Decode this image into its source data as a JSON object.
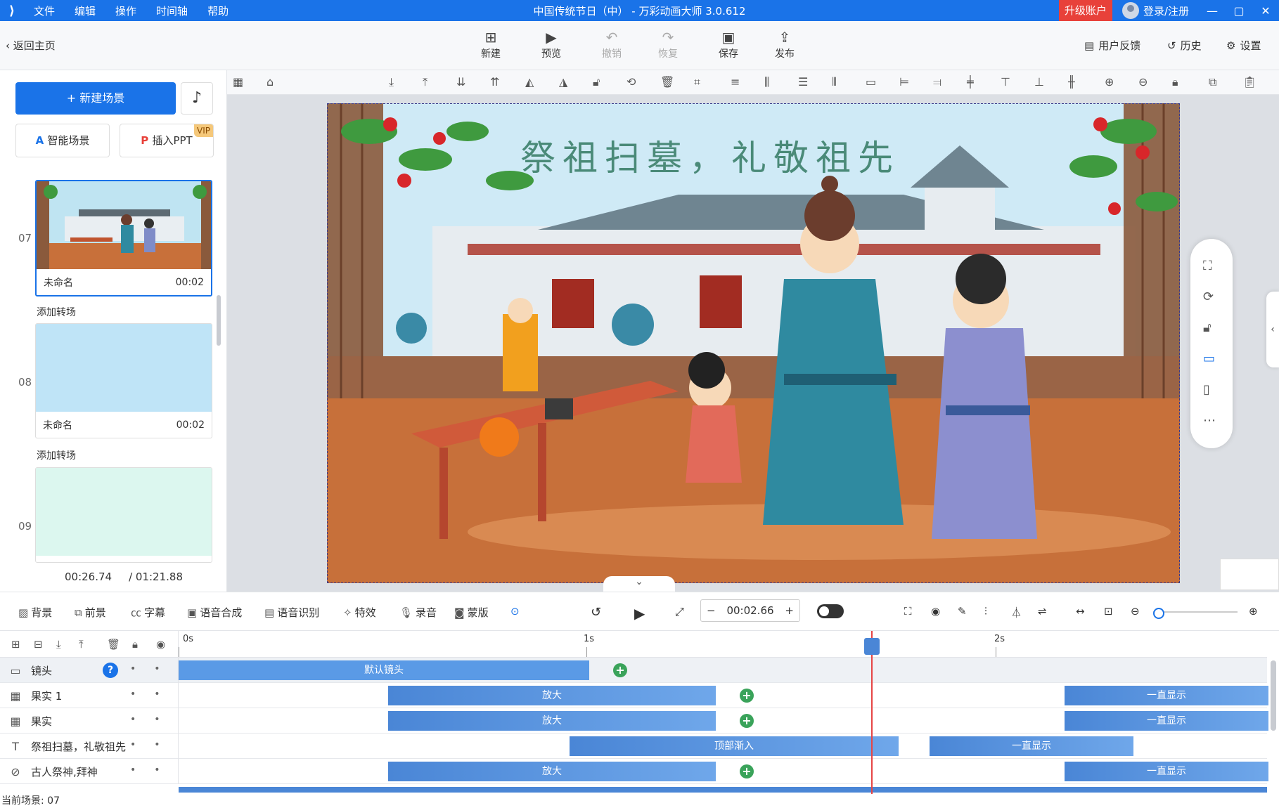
{
  "app": {
    "title": "中国传统节日（中） - 万彩动画大师 3.0.612",
    "menu": [
      "文件",
      "编辑",
      "操作",
      "时间轴",
      "帮助"
    ],
    "upgrade": "升级账户",
    "login": "登录/注册"
  },
  "toolbar": {
    "back": "返回主页",
    "new": "新建",
    "preview": "预览",
    "undo": "撤销",
    "redo": "恢复",
    "save": "保存",
    "publish": "发布",
    "feedback": "用户反馈",
    "history": "历史",
    "settings": "设置"
  },
  "left": {
    "new_scene": "+ 新建场景",
    "smart_scene": "智能场景",
    "insert_ppt": "插入PPT",
    "vip": "VIP",
    "add_transition": "添加转场",
    "scenes": [
      {
        "no": "07",
        "name": "未命名",
        "dur": "00:02"
      },
      {
        "no": "08",
        "name": "未命名",
        "dur": "00:02"
      },
      {
        "no": "09",
        "name": "",
        "dur": ""
      }
    ],
    "time_current": "00:26.74",
    "time_total": "/ 01:21.88"
  },
  "canvas": {
    "headline": "祭祖扫墓，礼敬祖先"
  },
  "controls": {
    "background": "背景",
    "foreground": "前景",
    "subtitle": "字幕",
    "tts": "语音合成",
    "asr": "语音识别",
    "effects": "特效",
    "record": "录音",
    "mask": "蒙版",
    "time": "00:02.66"
  },
  "timeline": {
    "ruler": [
      "0s",
      "1s",
      "2s"
    ],
    "status": "当前场景: 07",
    "tracks": [
      {
        "name": "镜头",
        "clips": [
          "默认镜头"
        ]
      },
      {
        "name": "果实 1",
        "clips": [
          "放大",
          "一直显示"
        ]
      },
      {
        "name": "果实",
        "clips": [
          "放大",
          "一直显示"
        ]
      },
      {
        "name": "祭祖扫墓，礼敬祖先",
        "clips": [
          "顶部渐入",
          "一直显示"
        ]
      },
      {
        "name": "古人祭神,拜神",
        "clips": [
          "放大",
          "一直显示"
        ]
      }
    ]
  },
  "colors": {
    "accent": "#1a73e8",
    "playhead": "#e64545",
    "keyframe": "#3aa35a",
    "upgrade": "#e8413a"
  }
}
